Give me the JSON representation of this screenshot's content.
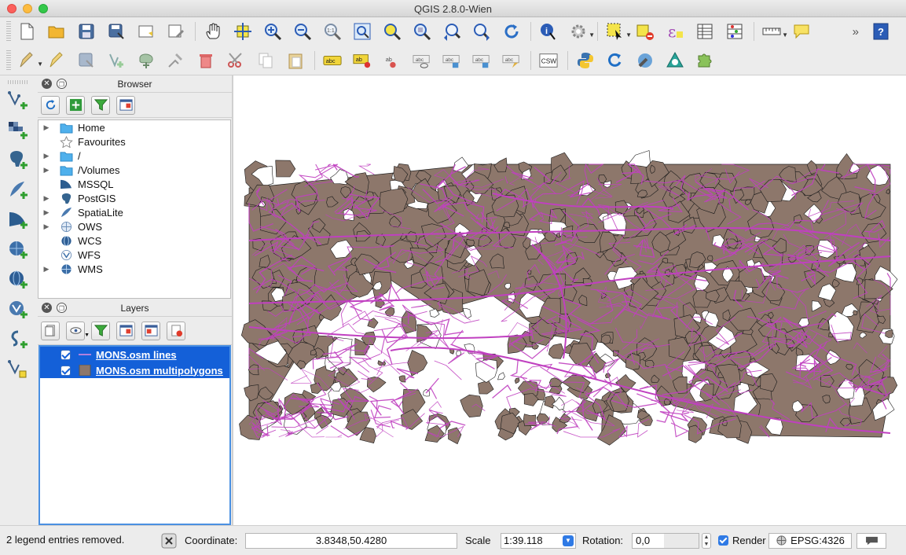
{
  "window": {
    "title": "QGIS 2.8.0-Wien"
  },
  "colors": {
    "polygon_fill": "#8d776b",
    "line_color": "#c040c0",
    "selection_blue": "#1460d8",
    "status_accent": "#2f7ae5"
  },
  "toolbar_top": {
    "icons": [
      "new-project-icon",
      "open-project-icon",
      "save-project-icon",
      "save-as-icon",
      "new-print-composer-icon",
      "composer-manager-icon",
      "pan-icon",
      "pan-to-selection-icon",
      "zoom-in-icon",
      "zoom-out-icon",
      "zoom-actual-icon",
      "zoom-full-icon",
      "zoom-to-selection-icon",
      "zoom-to-layer-icon",
      "zoom-last-icon",
      "zoom-next-icon",
      "refresh-icon",
      "identify-icon",
      "action-icon",
      "select-icon",
      "deselect-icon",
      "expression-select-icon",
      "attribute-table-icon",
      "statistics-icon",
      "measure-icon",
      "map-tips-icon",
      "help-icon"
    ]
  },
  "toolbar_second": {
    "icons": [
      "current-edits-icon",
      "toggle-editing-icon",
      "save-edits-icon",
      "add-feature-icon",
      "move-feature-icon",
      "node-tool-icon",
      "delete-selected-icon",
      "cut-features-icon",
      "copy-features-icon",
      "paste-features-icon",
      "label-icon",
      "pin-label-icon",
      "highlight-label-icon",
      "show-hide-label-icon",
      "move-label-icon",
      "rotate-label-icon",
      "change-label-icon",
      "csw-icon",
      "python-console-icon",
      "rotate-icon",
      "plugin-wrench-icon",
      "georeferencer-icon",
      "plugin-puzzle-icon"
    ],
    "csw_label": "CSW",
    "abc_label": "abc",
    "ab_label": "ab"
  },
  "left_toolbar": {
    "icons": [
      "add-vector-layer-icon",
      "add-raster-layer-icon",
      "add-postgis-layer-icon",
      "add-spatialite-layer-icon",
      "add-mssql-layer-icon",
      "add-wms-layer-icon",
      "add-wcs-layer-icon",
      "add-wfs-layer-icon",
      "add-delimited-text-icon",
      "new-shapefile-icon"
    ]
  },
  "browser": {
    "title": "Browser",
    "items": [
      {
        "label": "Home",
        "icon": "folder-icon",
        "expandable": true
      },
      {
        "label": "Favourites",
        "icon": "star-icon",
        "expandable": false
      },
      {
        "label": "/",
        "icon": "folder-icon",
        "expandable": true
      },
      {
        "label": "/Volumes",
        "icon": "folder-icon",
        "expandable": true
      },
      {
        "label": "MSSQL",
        "icon": "mssql-icon",
        "expandable": false
      },
      {
        "label": "PostGIS",
        "icon": "postgis-icon",
        "expandable": true
      },
      {
        "label": "SpatiaLite",
        "icon": "spatialite-icon",
        "expandable": true
      },
      {
        "label": "OWS",
        "icon": "ows-icon",
        "expandable": true
      },
      {
        "label": "WCS",
        "icon": "wcs-icon",
        "expandable": false
      },
      {
        "label": "WFS",
        "icon": "wfs-icon",
        "expandable": false
      },
      {
        "label": "WMS",
        "icon": "wms-icon",
        "expandable": true
      }
    ]
  },
  "layers": {
    "title": "Layers",
    "items": [
      {
        "label": "MONS.osm lines",
        "checked": true,
        "symbol": "line"
      },
      {
        "label": "MONS.osm multipolygons",
        "checked": true,
        "symbol": "polygon"
      }
    ]
  },
  "status": {
    "message": "2 legend entries removed.",
    "coordinate_label": "Coordinate:",
    "coordinate_value": "3.8348,50.4280",
    "scale_label": "Scale",
    "scale_value": "1:39.118",
    "rotation_label": "Rotation:",
    "rotation_value": "0,0",
    "render_label": "Render",
    "render_checked": true,
    "crs": "EPSG:4326"
  }
}
